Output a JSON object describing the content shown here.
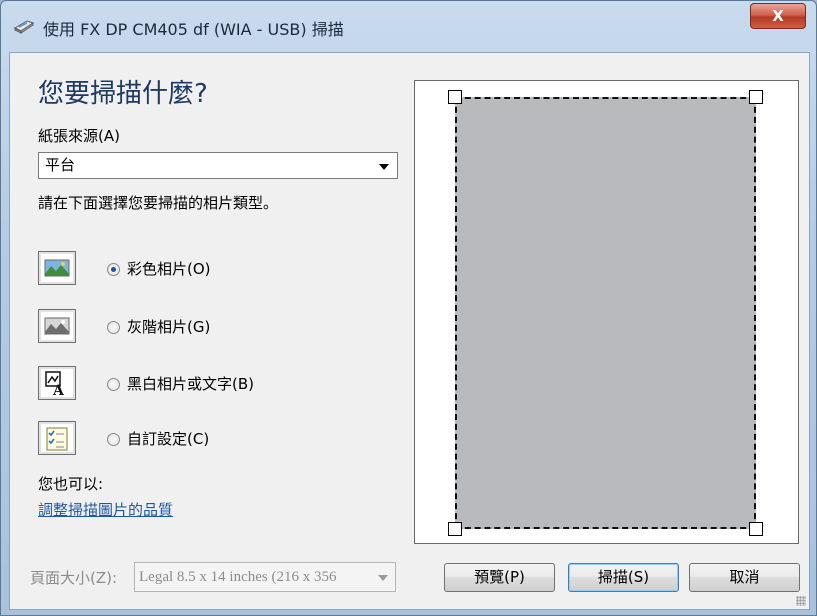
{
  "window": {
    "title": "使用 FX DP CM405 df (WIA - USB) 掃描",
    "close_label": "X"
  },
  "main": {
    "heading": "您要掃描什麼?",
    "paper_source_label": "紙張來源(A)",
    "paper_source_value": "平台",
    "instruction": "請在下面選擇您要掃描的相片類型。",
    "picture_types": [
      {
        "label": "彩色相片(O)",
        "icon": "color-photo-icon",
        "selected": true
      },
      {
        "label": "灰階相片(G)",
        "icon": "grayscale-photo-icon",
        "selected": false
      },
      {
        "label": "黑白相片或文字(B)",
        "icon": "black-white-text-icon",
        "selected": false
      },
      {
        "label": "自訂設定(C)",
        "icon": "custom-settings-icon",
        "selected": false
      }
    ],
    "also_label": "您也可以:",
    "adjust_quality_link": "調整掃描圖片的品質",
    "page_size_label": "頁面大小(Z):",
    "page_size_value": "Legal 8.5 x 14 inches (216 x 356"
  },
  "buttons": {
    "preview": "預覽(P)",
    "scan": "掃描(S)",
    "cancel": "取消"
  }
}
